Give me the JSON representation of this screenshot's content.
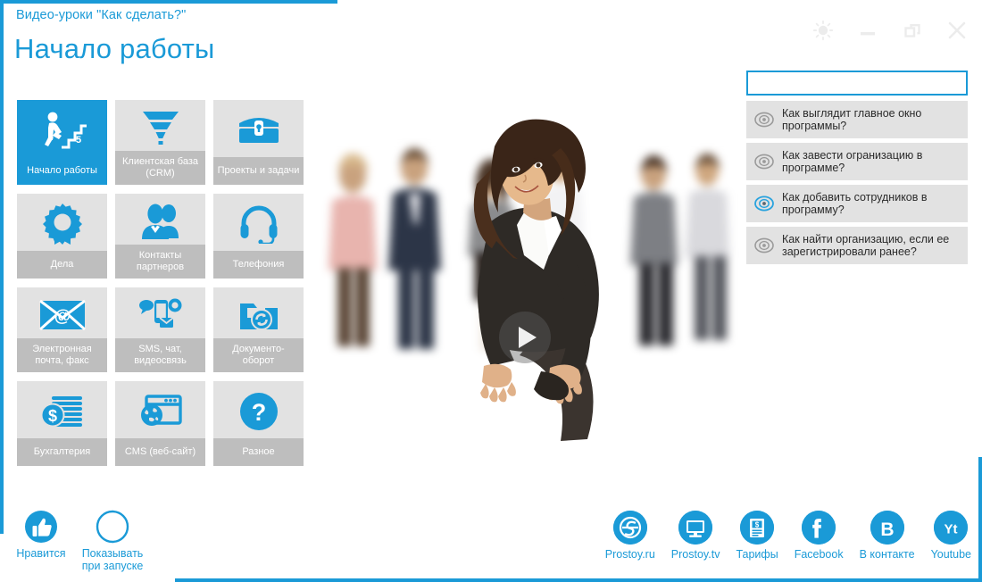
{
  "window": {
    "subtitle": "Видео-уроки \"Как сделать?\"",
    "title": "Начало работы",
    "controls": [
      {
        "name": "brightness-icon",
        "label": "Яркость"
      },
      {
        "name": "minimize-icon",
        "label": "Свернуть"
      },
      {
        "name": "restore-icon",
        "label": "Развернуть"
      },
      {
        "name": "close-icon",
        "label": "Закрыть"
      }
    ]
  },
  "accent_color": "#1a9ad7",
  "tile_bg_color": "#e2e2e2",
  "tile_label_color": "#bebebe",
  "tiles": [
    {
      "label": "Начало работы",
      "icon": "stairs-walk-icon",
      "active": true
    },
    {
      "label": "Клиентская база (CRM)",
      "icon": "funnel-icon",
      "active": false
    },
    {
      "label": "Проекты и задачи",
      "icon": "chest-icon",
      "active": false
    },
    {
      "label": "Дела",
      "icon": "award-rosette-icon",
      "active": false
    },
    {
      "label": "Контакты партнеров",
      "icon": "people-icon",
      "active": false
    },
    {
      "label": "Телефония",
      "icon": "headset-icon",
      "active": false
    },
    {
      "label": "Электронная почта, факс",
      "icon": "envelope-at-icon",
      "active": false
    },
    {
      "label": "SMS, чат, видеосвязь",
      "icon": "chat-phone-icon",
      "active": false
    },
    {
      "label": "Документо- оборот",
      "icon": "folder-sync-icon",
      "active": false
    },
    {
      "label": "Бухгалтерия",
      "icon": "coins-dollar-icon",
      "active": false
    },
    {
      "label": "CMS (веб-сайт)",
      "icon": "browser-globe-icon",
      "active": false
    },
    {
      "label": "Разное",
      "icon": "question-mark-icon",
      "active": false
    }
  ],
  "video": {
    "play_button": "play-icon"
  },
  "search": {
    "value": "",
    "placeholder": ""
  },
  "video_list": [
    {
      "text": "Как выглядит главное окно программы?",
      "watched": false
    },
    {
      "text": "Как завести огранизацию в программе?",
      "watched": false
    },
    {
      "text": "Как добавить сотрудников в программу?",
      "watched": true
    },
    {
      "text": "Как найти организацию, если ее зарегистрировали ранее?",
      "watched": false
    }
  ],
  "bottom_left": [
    {
      "label": "Нравится",
      "icon": "thumbs-up-icon"
    },
    {
      "label": "Показывать при запуске",
      "icon": "empty-circle-icon"
    }
  ],
  "bottom_right": [
    {
      "label": "Prostoy.ru",
      "icon": "prostoy-s-icon"
    },
    {
      "label": "Prostoy.tv",
      "icon": "monitor-icon"
    },
    {
      "label": "Тарифы",
      "icon": "price-list-icon"
    },
    {
      "label": "Facebook",
      "icon": "facebook-icon"
    },
    {
      "label": "В контакте",
      "icon": "vkontakte-icon"
    },
    {
      "label": "Youtube",
      "icon": "youtube-icon"
    }
  ]
}
